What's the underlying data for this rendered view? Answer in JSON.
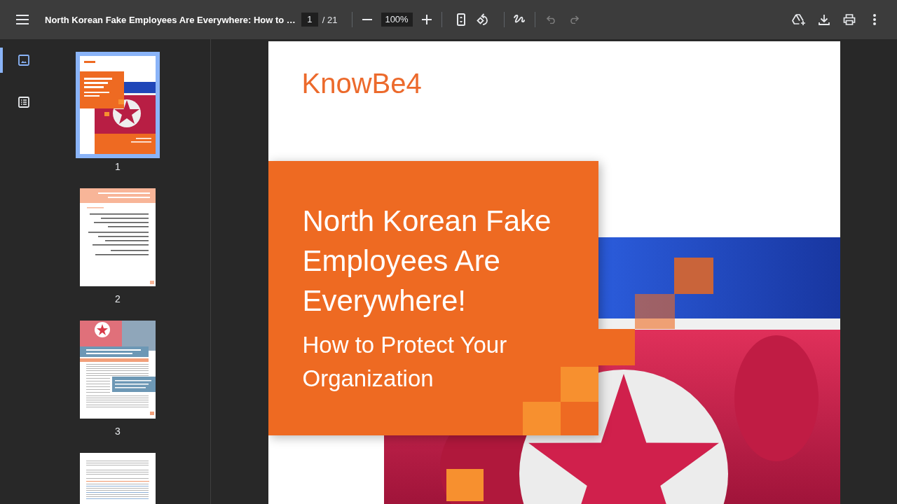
{
  "toolbar": {
    "title": "North Korean Fake Employees Are Everywhere: How to …",
    "page_input": {
      "value": "1"
    },
    "page_total": "/ 21",
    "zoom_input": {
      "value": "100%"
    },
    "undo": {
      "disabled": true
    },
    "redo": {
      "disabled": true
    }
  },
  "sidebar": {
    "views": [
      {
        "kind": "thumbnails",
        "selected": true
      },
      {
        "kind": "outline",
        "selected": false
      }
    ],
    "pages": [
      {
        "kind": "cover",
        "label": "1",
        "selected": true
      },
      {
        "kind": "contents",
        "label": "2",
        "selected": false
      },
      {
        "kind": "article",
        "label": "3",
        "selected": false
      },
      {
        "kind": "text",
        "selected": false
      }
    ]
  },
  "document": {
    "logo": "KnowBe4",
    "title": "North Korean Fake Employees Are Everywhere!",
    "subtitle": "How to Protect Your Organization"
  }
}
